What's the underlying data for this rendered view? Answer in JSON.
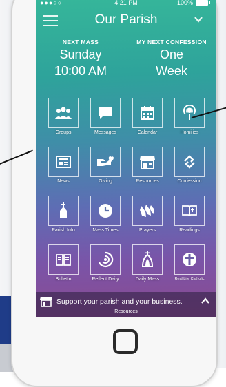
{
  "status_bar": {
    "signal": "●●●○○",
    "time": "4:21 PM",
    "battery": "100%"
  },
  "header": {
    "title": "Our Parish"
  },
  "next_mass": {
    "label": "NEXT MASS",
    "day": "Sunday",
    "time": "10:00 AM"
  },
  "next_confession": {
    "label": "MY NEXT CONFESSION",
    "line1": "One",
    "line2": "Week"
  },
  "tiles": [
    {
      "label": "Groups",
      "icon": "groups-icon"
    },
    {
      "label": "Messages",
      "icon": "message-icon"
    },
    {
      "label": "Calendar",
      "icon": "calendar-icon"
    },
    {
      "label": "Homilies",
      "icon": "podcast-icon"
    },
    {
      "label": "News",
      "icon": "newspaper-icon"
    },
    {
      "label": "Giving",
      "icon": "giving-icon"
    },
    {
      "label": "Resources",
      "icon": "store-icon"
    },
    {
      "label": "Confession",
      "icon": "confession-icon"
    },
    {
      "label": "Parish Info",
      "icon": "church-icon"
    },
    {
      "label": "Mass Times",
      "icon": "clock-icon"
    },
    {
      "label": "Prayers",
      "icon": "praying-hands-icon"
    },
    {
      "label": "Readings",
      "icon": "book-icon"
    },
    {
      "label": "Bulletin",
      "icon": "bulletin-icon"
    },
    {
      "label": "Reflect Daily",
      "icon": "reflect-icon"
    },
    {
      "label": "Daily Mass",
      "icon": "daily-mass-icon"
    },
    {
      "label": "Real Life Catholic",
      "icon": "real-life-catholic-icon"
    }
  ],
  "bottom_bar": {
    "message": "Support your parish and your business.",
    "sub": "Resources"
  }
}
